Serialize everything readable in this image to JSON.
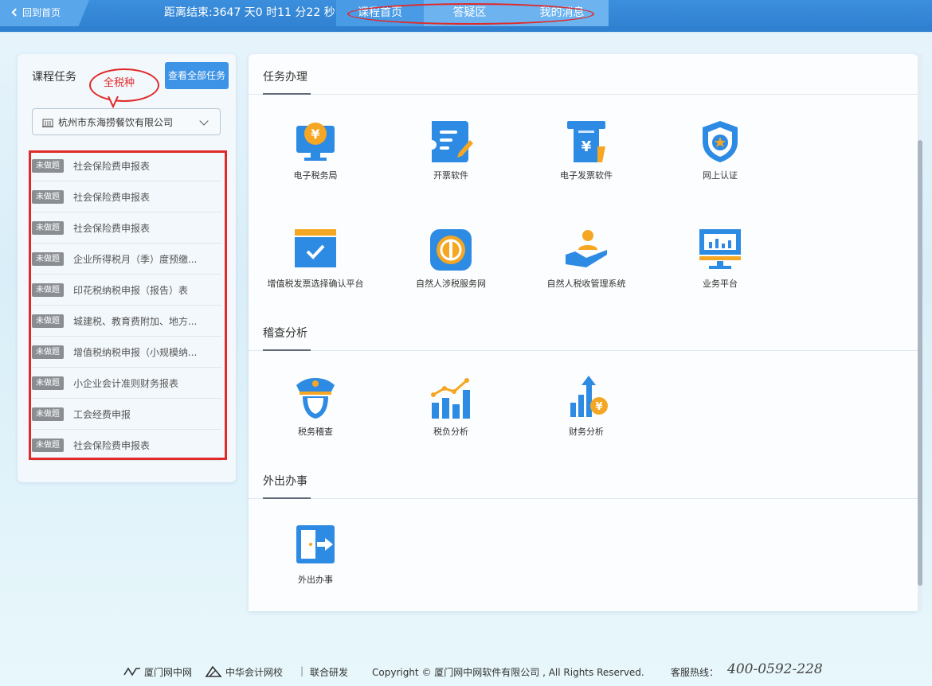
{
  "topbar": {
    "back_label": "回到首页",
    "countdown": "距离结束:3647 天0 时11 分22 秒",
    "nav": [
      "课程首页",
      "答疑区",
      "我的消息"
    ],
    "active_nav": "课程首页"
  },
  "sidebar": {
    "title": "课程任务",
    "all_tasks_button": "查看全部任务",
    "callout": "全税种",
    "company": "杭州市东海捞餐饮有限公司",
    "tasks": [
      {
        "status": "未做题",
        "name": "社会保险费申报表"
      },
      {
        "status": "未做题",
        "name": "社会保险费申报表"
      },
      {
        "status": "未做题",
        "name": "社会保险费申报表"
      },
      {
        "status": "未做题",
        "name": "企业所得税月（季）度预缴..."
      },
      {
        "status": "未做题",
        "name": "印花税纳税申报（报告）表"
      },
      {
        "status": "未做题",
        "name": "城建税、教育费附加、地方..."
      },
      {
        "status": "未做题",
        "name": "增值税纳税申报（小规模纳..."
      },
      {
        "status": "未做题",
        "name": "小企业会计准则财务报表"
      },
      {
        "status": "未做题",
        "name": "工会经费申报"
      },
      {
        "status": "未做题",
        "name": "社会保险费申报表"
      }
    ]
  },
  "main": {
    "sections": [
      {
        "title": "任务办理",
        "tiles": [
          {
            "label": "电子税务局",
            "icon": "e-tax-bureau-icon"
          },
          {
            "label": "开票软件",
            "icon": "invoicing-software-icon"
          },
          {
            "label": "电子发票软件",
            "icon": "e-invoice-software-icon"
          },
          {
            "label": "网上认证",
            "icon": "online-certification-icon"
          },
          {
            "label": "增值税发票选择确认平台",
            "icon": "vat-invoice-confirm-icon"
          },
          {
            "label": "自然人涉税服务网",
            "icon": "individual-tax-service-icon"
          },
          {
            "label": "自然人税收管理系统",
            "icon": "individual-tax-management-icon"
          },
          {
            "label": "业务平台",
            "icon": "business-platform-icon"
          }
        ]
      },
      {
        "title": "稽查分析",
        "tiles": [
          {
            "label": "税务稽查",
            "icon": "tax-inspection-icon"
          },
          {
            "label": "税负分析",
            "icon": "tax-burden-analysis-icon"
          },
          {
            "label": "财务分析",
            "icon": "financial-analysis-icon"
          }
        ]
      },
      {
        "title": "外出办事",
        "tiles": [
          {
            "label": "外出办事",
            "icon": "going-out-icon"
          }
        ]
      }
    ]
  },
  "footer": {
    "brand1": "厦门网中网",
    "brand2": "中华会计网校",
    "joint": "联合研发",
    "copyright": "Copyright © 厦门网中网软件有限公司 , All Rights Reserved.",
    "hotline_label": "客服热线：",
    "hotline_number": "400-0592-228"
  },
  "colors": {
    "topbar": "#2f7fd0",
    "accent": "#3d93e6",
    "annotation_red": "#e02a2a",
    "badge_gray": "#8a8e93"
  }
}
